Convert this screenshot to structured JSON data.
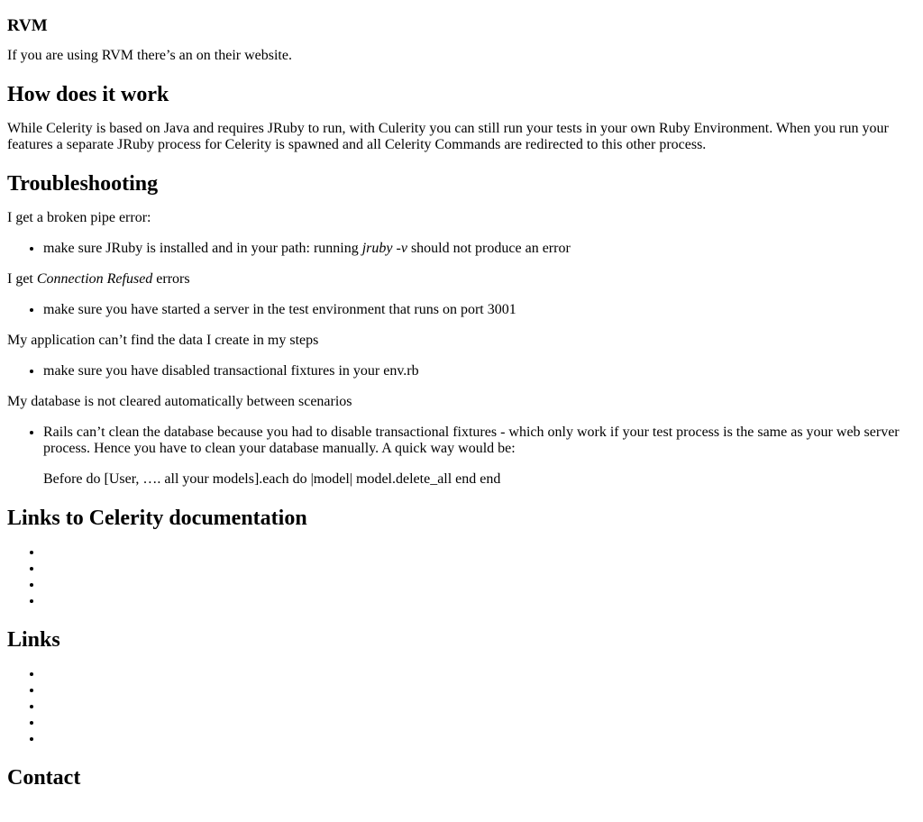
{
  "rvm": {
    "heading": "RVM",
    "text_before": "If you are using RVM there’s an",
    "text_after": "on their website."
  },
  "how": {
    "heading": "How does it work",
    "paragraph": "While Celerity is based on Java and requires JRuby to run, with Culerity you can still run your tests in your own Ruby Environment. When you run your features a separate JRuby process for Celerity is spawned and all Celerity Commands are redirected to this other process."
  },
  "troubleshooting": {
    "heading": "Troubleshooting",
    "broken_pipe": {
      "question": "I get a broken pipe error:",
      "answer_before": "make sure JRuby is installed and in your path: running",
      "answer_code": "jruby -v",
      "answer_after": "should not produce an error"
    },
    "refused": {
      "question_before": "I get",
      "question_em": "Connection Refused",
      "question_after": "errors",
      "answer": "make sure you have started a server in the test environment that runs on port 3001"
    },
    "data": {
      "question": "My application can’t find the data I create in my steps",
      "answer": "make sure you have disabled transactional fixtures in your env.rb"
    },
    "database": {
      "question": "My database is not cleared automatically between scenarios",
      "answer": "Rails can’t clean the database because you had to disable transactional fixtures - which only work if your test process is the same as your web server process. Hence you have to clean your database manually. A quick way would be:",
      "code": "Before do [User, …. all your models].each do |model| model.delete_all end end"
    }
  },
  "celerity_docs": {
    "heading": "Links to Celerity documentation",
    "items": [
      "",
      "",
      "",
      ""
    ]
  },
  "links": {
    "heading": "Links",
    "items": [
      "",
      "",
      "",
      "",
      ""
    ]
  },
  "contact": {
    "heading": "Contact"
  }
}
